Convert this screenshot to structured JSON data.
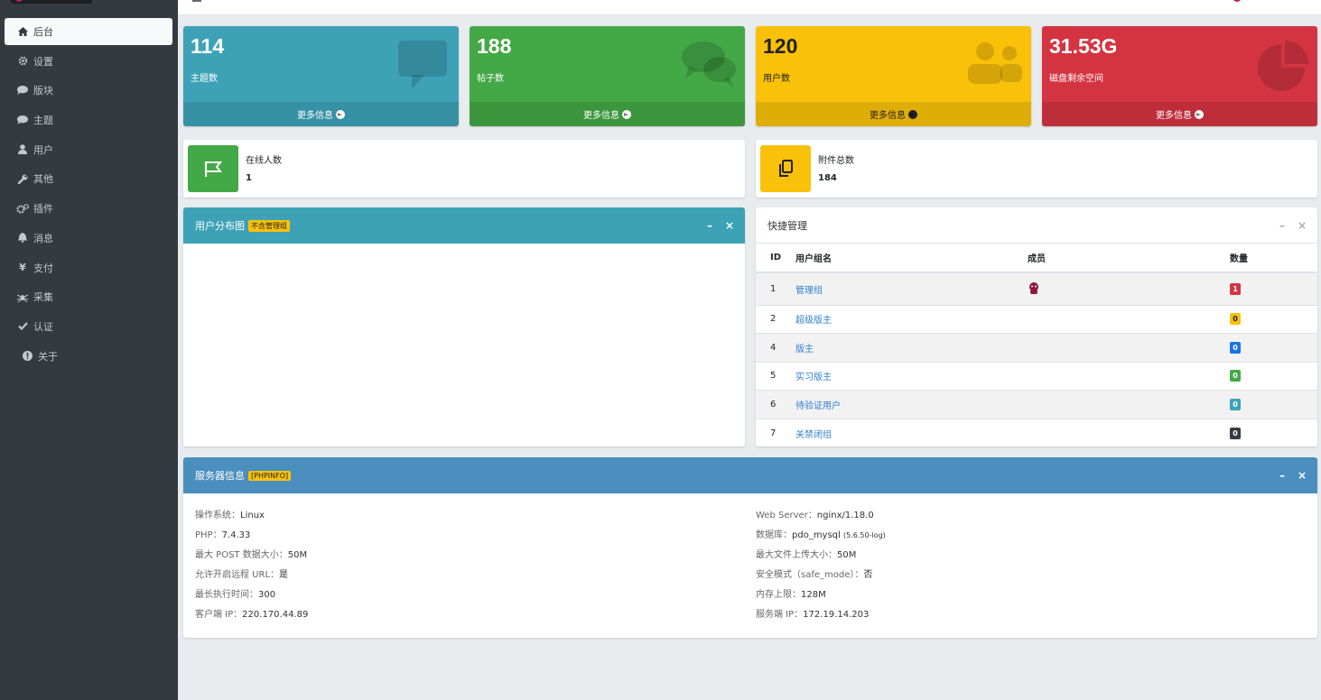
{
  "sidebar": {
    "items": [
      {
        "label": "后台",
        "icon": "home-icon"
      },
      {
        "label": "设置",
        "icon": "gear-icon"
      },
      {
        "label": "版块",
        "icon": "comment-icon"
      },
      {
        "label": "主题",
        "icon": "comment-icon"
      },
      {
        "label": "用户",
        "icon": "user-icon"
      },
      {
        "label": "其他",
        "icon": "wrench-icon"
      },
      {
        "label": "插件",
        "icon": "cogs-icon"
      },
      {
        "label": "消息",
        "icon": "bell-icon"
      },
      {
        "label": "支付",
        "icon": "yen-icon"
      },
      {
        "label": "采集",
        "icon": "spider-icon"
      },
      {
        "label": "认证",
        "icon": "check-icon"
      },
      {
        "label": "关于",
        "icon": "info-icon"
      }
    ]
  },
  "stats": [
    {
      "value": "114",
      "label": "主题数",
      "more": "更多信息",
      "icon": "comment-icon",
      "color": "#3ea2b7"
    },
    {
      "value": "188",
      "label": "帖子数",
      "more": "更多信息",
      "icon": "comments-icon",
      "color": "#43a846"
    },
    {
      "value": "120",
      "label": "用户数",
      "more": "更多信息",
      "icon": "users-icon",
      "color": "#f9c10a"
    },
    {
      "value": "31.53G",
      "label": "磁盘剩余空间",
      "more": "更多信息",
      "icon": "pie-chart-icon",
      "color": "#d43441"
    }
  ],
  "info": [
    {
      "label": "在线人数",
      "value": "1",
      "icon": "flag-icon"
    },
    {
      "label": "附件总数",
      "value": "184",
      "icon": "copy-icon"
    }
  ],
  "user_chart": {
    "title": "用户分布图",
    "tag": "不含管理组"
  },
  "quick": {
    "title": "快捷管理",
    "headers": [
      "ID",
      "用户组名",
      "成员",
      "数量"
    ],
    "rows": [
      {
        "id": "1",
        "name": "管理组",
        "count": "1",
        "color": "#d43441"
      },
      {
        "id": "2",
        "name": "超级版主",
        "count": "0",
        "color": "#f9c10a"
      },
      {
        "id": "4",
        "name": "版主",
        "count": "0",
        "color": "#1a73e8"
      },
      {
        "id": "5",
        "name": "实习版主",
        "count": "0",
        "color": "#43a846"
      },
      {
        "id": "6",
        "name": "待验证用户",
        "count": "0",
        "color": "#3ea2b7"
      },
      {
        "id": "7",
        "name": "关禁闭组",
        "count": "0",
        "color": "#343a40"
      }
    ]
  },
  "server": {
    "title": "服务器信息",
    "tag": "[PHPINFO]",
    "left": [
      {
        "k": "操作系统：",
        "v": "Linux"
      },
      {
        "k": "PHP：",
        "v": "7.4.33"
      },
      {
        "k": "最大 POST 数据大小：",
        "v": "50M"
      },
      {
        "k": "允许开启远程 URL：",
        "v": "是"
      },
      {
        "k": "最长执行时间：",
        "v": "300"
      },
      {
        "k": "客户端 IP：",
        "v": "220.170.44.89"
      }
    ],
    "right": [
      {
        "k": "Web Server：",
        "v": "nginx/1.18.0"
      },
      {
        "k": "数据库：",
        "v": "pdo_mysql",
        "small": "(5.6.50-log)"
      },
      {
        "k": "最大文件上传大小：",
        "v": "50M"
      },
      {
        "k": "安全模式（safe_mode）：",
        "v": "否"
      },
      {
        "k": "内存上限：",
        "v": "128M"
      },
      {
        "k": "服务端 IP：",
        "v": "172.19.14.203"
      }
    ]
  }
}
